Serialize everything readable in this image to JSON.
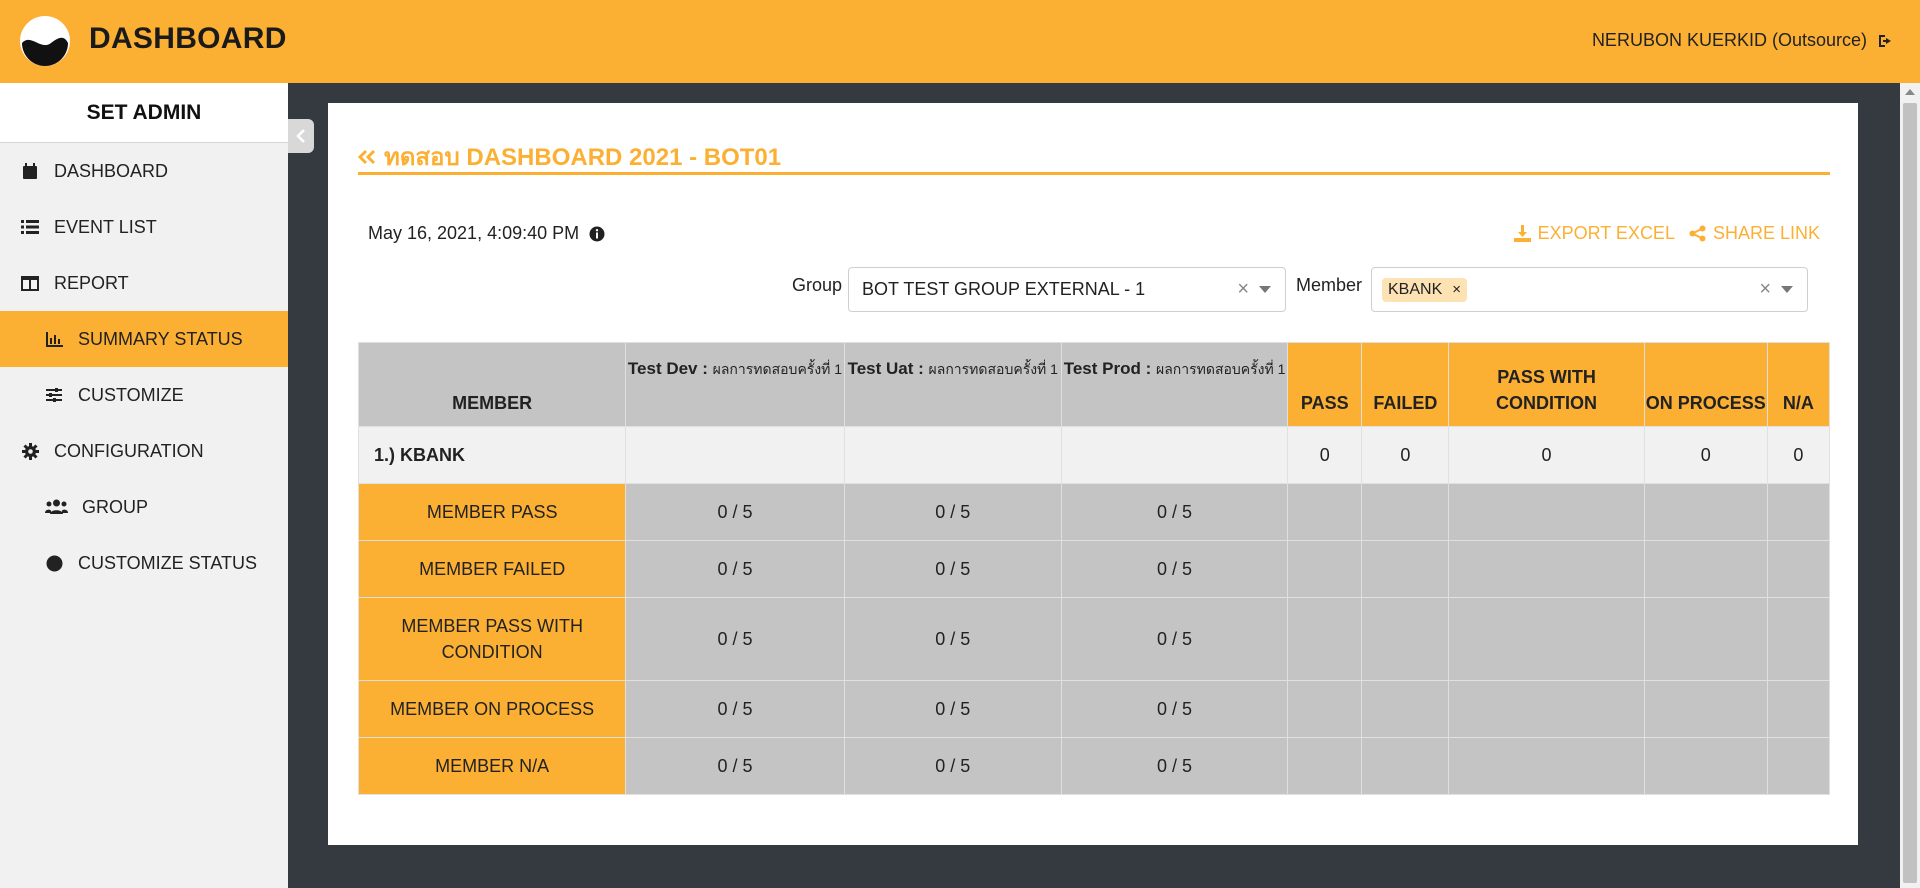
{
  "header": {
    "brand": "DASHBOARD",
    "user": "NERUBON KUERKID (Outsource)"
  },
  "sidebar": {
    "title": "SET ADMIN",
    "items": [
      {
        "label": "DASHBOARD",
        "icon": "calendar-icon"
      },
      {
        "label": "EVENT LIST",
        "icon": "list-icon"
      },
      {
        "label": "REPORT",
        "icon": "columns-icon"
      },
      {
        "label": "SUMMARY STATUS",
        "icon": "chart-bar-icon",
        "active": true
      },
      {
        "label": "CUSTOMIZE",
        "icon": "sliders-icon"
      },
      {
        "label": "CONFIGURATION",
        "icon": "gear-icon"
      },
      {
        "label": "GROUP",
        "icon": "users-icon"
      },
      {
        "label": "CUSTOMIZE STATUS",
        "icon": "circle-icon"
      }
    ]
  },
  "page": {
    "title": "ทดสอบ DASHBOARD 2021 - BOT01",
    "timestamp": "May 16, 2021, 4:09:40 PM",
    "export_label": "EXPORT EXCEL",
    "share_label": "SHARE LINK"
  },
  "filters": {
    "group_label": "Group",
    "group_value": "BOT TEST GROUP EXTERNAL - 1",
    "member_label": "Member",
    "member_chip": "KBANK"
  },
  "table": {
    "headers": {
      "member": "MEMBER",
      "test_dev": "Test Dev :",
      "test_uat": "Test Uat :",
      "test_prod": "Test Prod :",
      "round": "ผลการทดสอบครั้งที่ 1",
      "pass": "PASS",
      "failed": "FAILED",
      "pass_with_condition": "PASS WITH CONDITION",
      "on_process": "ON PROCESS",
      "na": "N/A"
    },
    "member_row": {
      "name": "1.) KBANK",
      "pass": "0",
      "failed": "0",
      "pass_with_condition": "0",
      "on_process": "0",
      "na": "0"
    },
    "rows": [
      {
        "label": "MEMBER PASS",
        "dev": "0 / 5",
        "uat": "0 / 5",
        "prod": "0 / 5"
      },
      {
        "label": "MEMBER FAILED",
        "dev": "0 / 5",
        "uat": "0 / 5",
        "prod": "0 / 5"
      },
      {
        "label": "MEMBER PASS WITH CONDITION",
        "dev": "0 / 5",
        "uat": "0 / 5",
        "prod": "0 / 5"
      },
      {
        "label": "MEMBER ON PROCESS",
        "dev": "0 / 5",
        "uat": "0 / 5",
        "prod": "0 / 5"
      },
      {
        "label": "MEMBER N/A",
        "dev": "0 / 5",
        "uat": "0 / 5",
        "prod": "0 / 5"
      }
    ]
  },
  "colors": {
    "accent": "#fbb034",
    "dark_bg": "#343a40",
    "gray_cell": "#c4c4c4"
  }
}
